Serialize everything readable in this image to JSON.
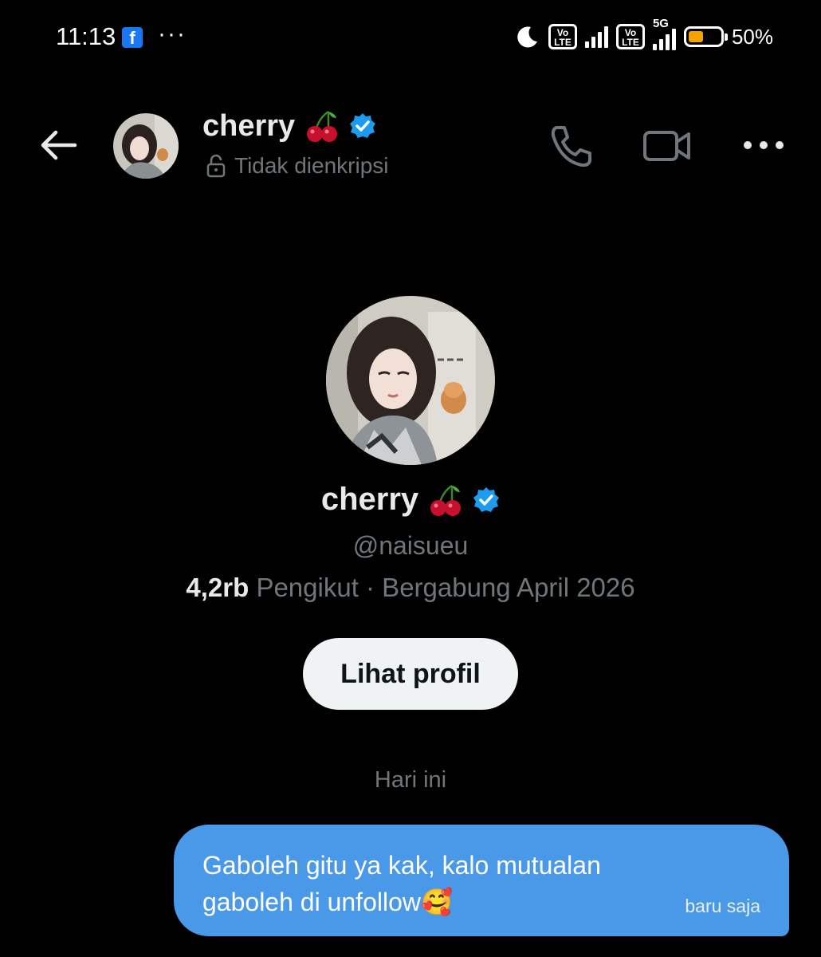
{
  "status_bar": {
    "time": "11:13",
    "volte_label_1": "Vo\nLTE",
    "volte_label_2": "Vo\nLTE",
    "network": "5G",
    "battery_percent": "50%",
    "battery_level": 0.5,
    "icons": [
      "facebook-icon",
      "more-dots-icon",
      "moon-icon",
      "volte-icon",
      "signal-icon",
      "volte-icon",
      "signal-5g-icon",
      "battery-icon"
    ]
  },
  "header": {
    "name": "cherry",
    "name_emoji": "cherry-emoji",
    "verified": true,
    "subtitle": "Tidak dienkripsi",
    "icons": [
      "back-arrow-icon",
      "lock-icon",
      "phone-icon",
      "video-camera-icon",
      "more-horizontal-icon"
    ]
  },
  "profile": {
    "name": "cherry",
    "handle": "@naisueu",
    "followers_count": "4,2rb",
    "followers_label": "Pengikut · Bergabung April 2026",
    "view_profile_label": "Lihat profil"
  },
  "conversation": {
    "date_separator": "Hari ini",
    "messages": [
      {
        "text": "Gaboleh gitu ya kak, kalo mutualan gaboleh di unfollow🥰",
        "time": "baru saja",
        "outgoing": true
      }
    ]
  },
  "colors": {
    "background": "#000000",
    "accent": "#1d9bf0",
    "bubble": "#4a99e9",
    "muted_text": "#71767b",
    "battery": "#f5a300"
  }
}
